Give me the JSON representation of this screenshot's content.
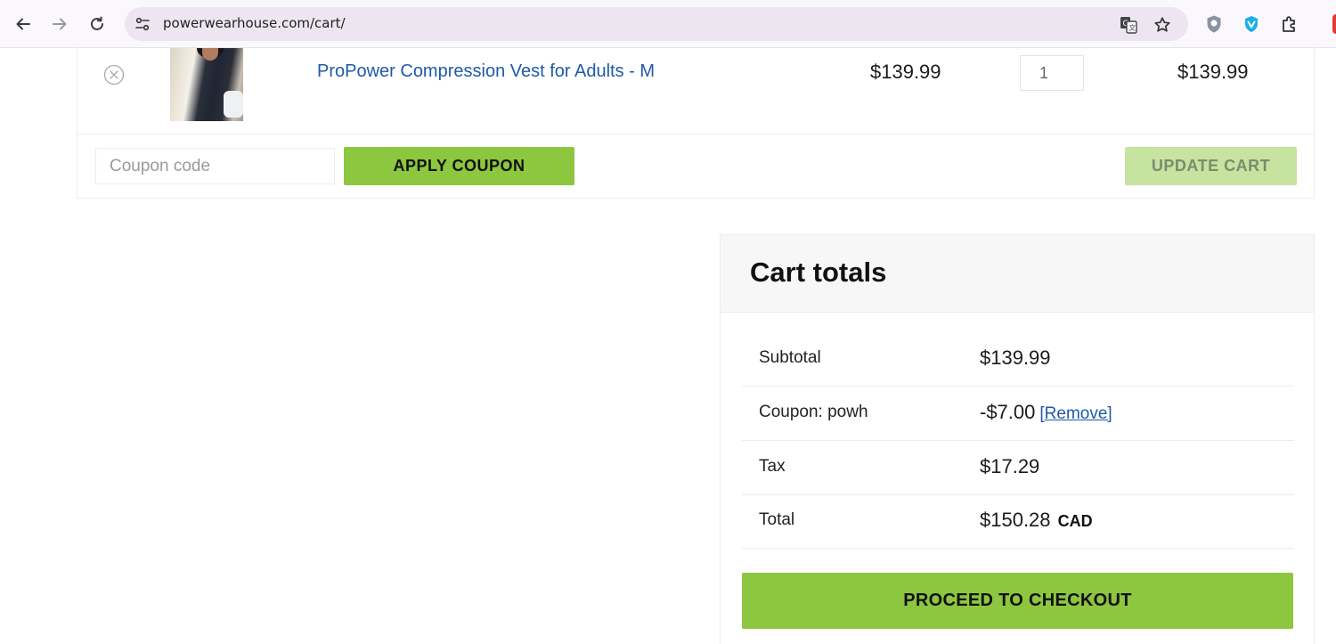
{
  "browser": {
    "url": "powerwearhouse.com/cart/",
    "icons": [
      "back-icon",
      "forward-icon",
      "reload-icon",
      "site-info-icon",
      "translate-icon",
      "bookmark-star-icon",
      "shield-extension-icon",
      "vpn-extension-icon",
      "extensions-puzzle-icon"
    ]
  },
  "cart": {
    "items": [
      {
        "name": "ProPower Compression Vest for Adults - M",
        "price": "$139.99",
        "quantity": "1",
        "subtotal": "$139.99"
      }
    ],
    "coupon_placeholder": "Coupon code",
    "apply_coupon_label": "APPLY COUPON",
    "update_cart_label": "UPDATE CART"
  },
  "totals": {
    "title": "Cart totals",
    "subtotal_label": "Subtotal",
    "subtotal_value": "$139.99",
    "coupon_label": "Coupon: powh",
    "coupon_value": "-$7.00",
    "coupon_remove": "[Remove]",
    "tax_label": "Tax",
    "tax_value": "$17.29",
    "total_label": "Total",
    "total_value": "$150.28",
    "total_currency": "CAD",
    "checkout_label": "PROCEED TO CHECKOUT"
  },
  "colors": {
    "accent_green": "#8dc63f",
    "disabled_green": "#c6e3a0",
    "link_blue": "#1e5aa8"
  }
}
